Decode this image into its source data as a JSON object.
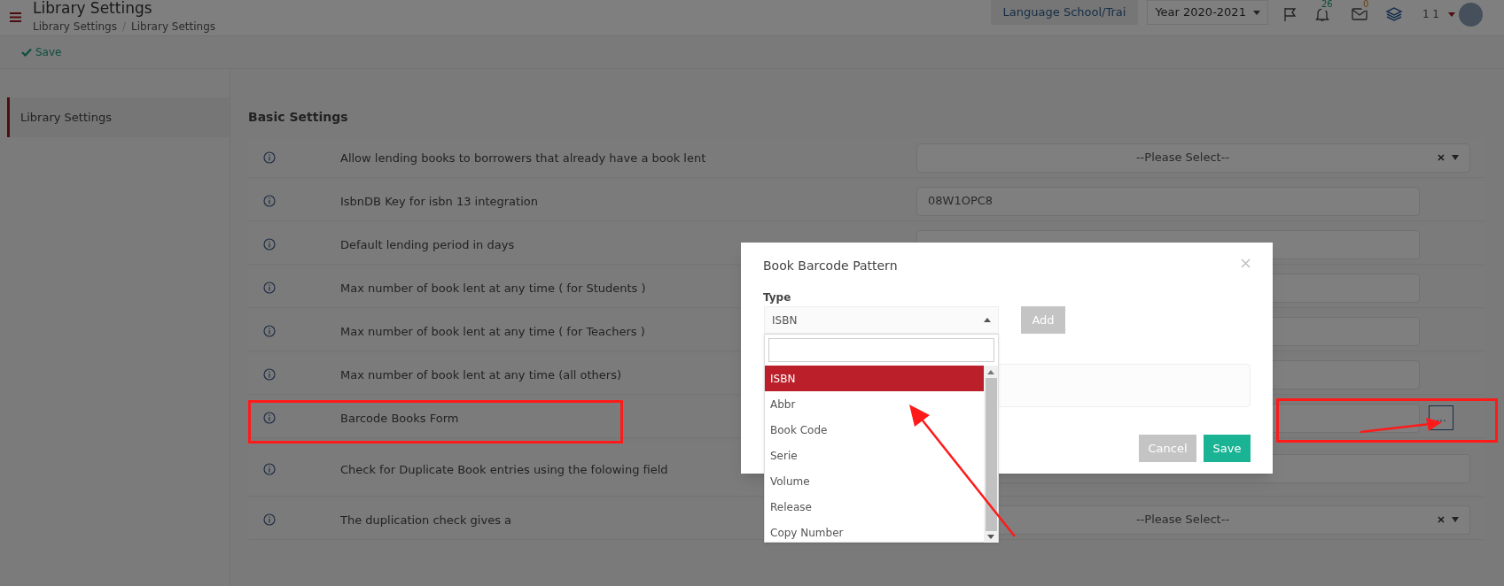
{
  "header": {
    "title": "Library Settings",
    "breadcrumb": [
      "Library Settings",
      "Library Settings"
    ],
    "breadcrumb_separator": "/",
    "school": "Language School/Trai",
    "year": "Year 2020-2021",
    "notifications_count": "26",
    "messages_count": "0",
    "user": "1 1"
  },
  "toolbar": {
    "save": "Save"
  },
  "sidebar": {
    "items": [
      {
        "label": "Library Settings",
        "selected": true
      }
    ]
  },
  "section_title": "Basic Settings",
  "settings": [
    {
      "label": "Allow lending books to borrowers that already have a book lent",
      "kind": "select",
      "value": "--Please Select--"
    },
    {
      "label": "IsbnDB Key for isbn 13 integration",
      "kind": "text",
      "value": "08W1OPC8"
    },
    {
      "label": "Default lending period in days",
      "kind": "text"
    },
    {
      "label": "Max number of book lent at any time ( for Students )",
      "kind": "text"
    },
    {
      "label": "Max number of book lent at any time ( for Teachers )",
      "kind": "text"
    },
    {
      "label": "Max number of book lent at any time (all others)",
      "kind": "text"
    },
    {
      "label": "Barcode Books Form",
      "kind": "button",
      "button": "..."
    },
    {
      "label": "Check for Duplicate Book entries using the folowing field",
      "kind": "wide"
    },
    {
      "label": "The duplication check gives a",
      "kind": "select",
      "value": "--Please Select--"
    }
  ],
  "modal": {
    "title": "Book Barcode Pattern",
    "type_label": "Type",
    "type_value": "ISBN",
    "add": "Add",
    "cancel": "Cancel",
    "save": "Save",
    "options": [
      {
        "label": "ISBN",
        "selected": true
      },
      {
        "label": "Abbr",
        "selected": false
      },
      {
        "label": "Book Code",
        "selected": false
      },
      {
        "label": "Serie",
        "selected": false
      },
      {
        "label": "Volume",
        "selected": false
      },
      {
        "label": "Release",
        "selected": false
      },
      {
        "label": "Copy Number",
        "selected": false
      }
    ]
  }
}
